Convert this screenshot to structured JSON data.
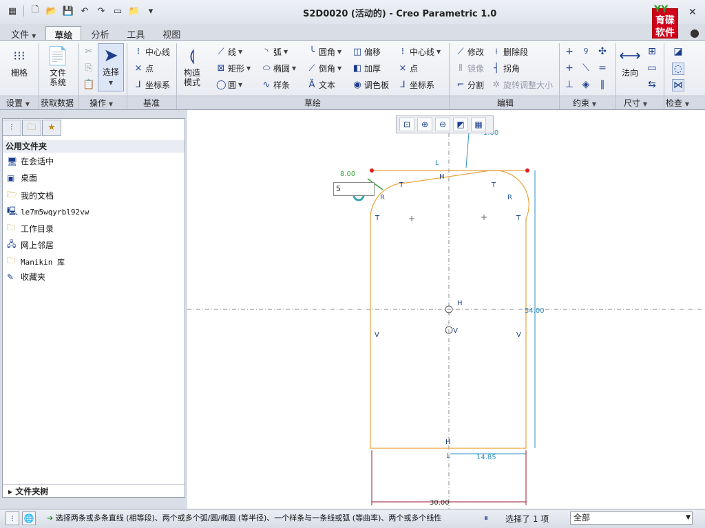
{
  "title": "S2D0020 (活动的) - Creo Parametric 1.0",
  "logo": {
    "top": "YY",
    "line1": "育碟",
    "line2": "软件"
  },
  "tabs": [
    "文件",
    "草绘",
    "分析",
    "工具",
    "视图"
  ],
  "ribbon": {
    "settings": {
      "grid": "栅格",
      "group": "设置"
    },
    "getdata": {
      "filesystem_1": "文件",
      "filesystem_2": "系统",
      "group": "获取数据"
    },
    "ops": {
      "select": "选择",
      "group": "操作"
    },
    "datum": {
      "centerline": "中心线",
      "point": "点",
      "coordsys": "坐标系",
      "group": "基准"
    },
    "construct": {
      "line1": "构造",
      "line2": "模式"
    },
    "sketch": {
      "line": "线",
      "rect": "矩形",
      "circle": "圆",
      "arc": "弧",
      "ellipse": "椭圆",
      "spline": "样条",
      "fillet": "圆角",
      "chamfer": "倒角",
      "text": "文本",
      "offset": "偏移",
      "thicken": "加厚",
      "palette": "调色板",
      "centerline": "中心线",
      "point": "点",
      "coordsys": "坐标系",
      "group": "草绘"
    },
    "edit": {
      "modify": "修改",
      "delete_seg": "删除段",
      "mirror": "镜像",
      "corner": "拐角",
      "divide": "分割",
      "rotate_resize": "旋转调整大小",
      "group": "编辑"
    },
    "constrain": {
      "group": "约束"
    },
    "dimension": {
      "normal": "法向",
      "group": "尺寸"
    },
    "inspect": {
      "group": "检查"
    }
  },
  "left_panel": {
    "header": "公用文件夹",
    "items": [
      "在会话中",
      "桌面",
      "我的文档",
      "le7m5wqyrbl92vw",
      "工作目录",
      "网上邻居",
      "Manikin 库",
      "收藏夹"
    ],
    "footer": "文件夹树"
  },
  "input_value": "5",
  "sketch_labels": {
    "dim_800": "8.00",
    "dim_top": "1.00",
    "dim_right": "54.00",
    "dim_bottom_small": "14.85",
    "dim_bottom": "30.00",
    "L1a": "L",
    "L1b": "L",
    "R1a": "R",
    "R1b": "R",
    "sub1": "1",
    "H": "H",
    "T": "T",
    "V": "V"
  },
  "status": {
    "message": "选择两条或多条直线 (相等段)、两个或多个弧/圆/椭圆 (等半径)、一个样条与一条线或弧 (等曲率)、两个或多个线性",
    "selected": "选择了 1 项",
    "filter": "全部"
  },
  "colors": {
    "accent": "#1a3e8c",
    "sketch_line": "#e6a23c",
    "dimension": "#2a8fc0",
    "dim_strong": "#a0102a",
    "weak_dim": "#3aa33a",
    "endpoint": "#e02020"
  }
}
